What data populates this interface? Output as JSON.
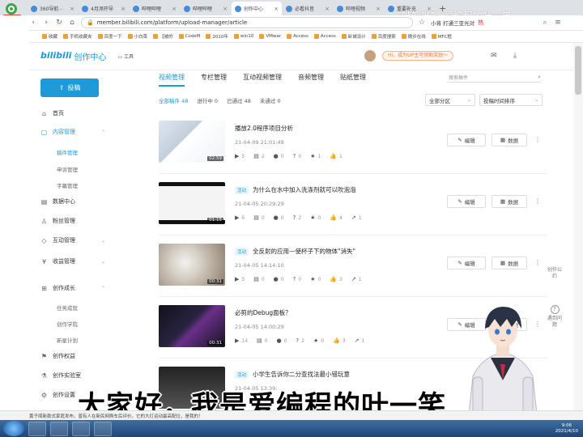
{
  "browser": {
    "tabs": [
      {
        "label": "360导航 -"
      },
      {
        "label": "4月添开导"
      },
      {
        "label": "哔哩哔哩"
      },
      {
        "label": "哔哩哔哩"
      },
      {
        "label": "创作中心"
      },
      {
        "label": "必看抖音"
      },
      {
        "label": "哔哩视频"
      },
      {
        "label": "重要补充"
      }
    ],
    "active_tab": 4,
    "url": "member.bilibili.com/platform/upload-manager/article",
    "search_text": "小将 打通三亚光对",
    "search_hot": "热",
    "bookmarks": [
      "收藏",
      "手机收藏夹",
      "百度一下",
      "小白菜",
      "【被的",
      "CodeM",
      "2010年",
      "win10",
      "VMwar",
      "Access",
      "Access",
      "卧城设计",
      "百度搜索",
      "微步在线",
      "MFC框"
    ],
    "badge": "新版"
  },
  "watermark": "哔哩哔哩  爱编程的叶一笑",
  "header": {
    "logo_brand": "bilibili",
    "logo_text": "创作中心",
    "tools_label": "工具",
    "promo": "Hi，成为UP主可领取奖励～",
    "mail_icon": "mail-icon",
    "download_icon": "download-icon"
  },
  "sidebar": {
    "upload_label": "投稿",
    "items": [
      {
        "label": "首页",
        "icon": "⌂"
      },
      {
        "label": "内容管理",
        "icon": "▢"
      },
      {
        "label": "数据中心",
        "icon": "▤"
      },
      {
        "label": "粉丝管理",
        "icon": "♙"
      },
      {
        "label": "互动管理",
        "icon": "◇"
      },
      {
        "label": "收益管理",
        "icon": "¥"
      },
      {
        "label": "创作成长",
        "icon": "⊞"
      },
      {
        "label": "创作权益",
        "icon": "⚑"
      },
      {
        "label": "创作实验室",
        "icon": "⚗"
      },
      {
        "label": "创作设置",
        "icon": "⚙"
      }
    ],
    "content_sub": [
      "稿件管理",
      "申诉管理",
      "字幕管理"
    ],
    "growth_sub": [
      "任务成就",
      "创作学院",
      "新星计划"
    ]
  },
  "main": {
    "tabs": [
      "视频管理",
      "专栏管理",
      "互动视频管理",
      "音频管理",
      "贴纸管理"
    ],
    "search_placeholder": "搜索稿件",
    "filters": [
      "全部稿件 48",
      "进行中 0",
      "已通过 48",
      "未通过 0"
    ],
    "zone_select": "全部分区",
    "sort_select": "投稿时间排序",
    "edit_label": "编辑",
    "data_label": "数据",
    "videos": [
      {
        "title": "播放2.0程序项目分析",
        "badge": "",
        "date": "21-04-09 21:01:49",
        "duration": "02:59",
        "stats": [
          "5",
          "2",
          "0",
          "0",
          "1",
          "1"
        ]
      },
      {
        "title": "为什么在水中加入洗涤剂就可以吹泡泡",
        "badge": "活动",
        "date": "21-04-05 20:29:29",
        "duration": "01:15",
        "stats": [
          "6",
          "0",
          "0",
          "2",
          "0",
          "4",
          "1"
        ]
      },
      {
        "title": "全反射的应用—使杯子下的物体\"消失\"",
        "badge": "活动",
        "date": "21-04-05 14:14:10",
        "duration": "00:31",
        "stats": [
          "5",
          "0",
          "0",
          "0",
          "0",
          "3",
          "1"
        ]
      },
      {
        "title": "必剪的Debug面板？",
        "badge": "",
        "date": "21-04-05 14:00:29",
        "duration": "00:31",
        "stats": [
          "14",
          "0",
          "0",
          "2",
          "0",
          "3",
          "1"
        ]
      },
      {
        "title": "小学生告诉你二分查找法最小错玩意",
        "badge": "活动",
        "date": "21-04-05 13:39:",
        "duration": "",
        "stats": []
      }
    ]
  },
  "right_float": [
    {
      "label": "创作公约"
    },
    {
      "label": "遇到问题"
    }
  ],
  "subtitle": "大家好，我是爱编程的叶一笑",
  "status_text": "黄子闻新款式家庭发布，曾有人在新民网购车后评价，它的大灯运动最高配位，是我的！",
  "tray": {
    "time": "9:06",
    "date": "2021/4/10",
    "zoom": "100%"
  }
}
